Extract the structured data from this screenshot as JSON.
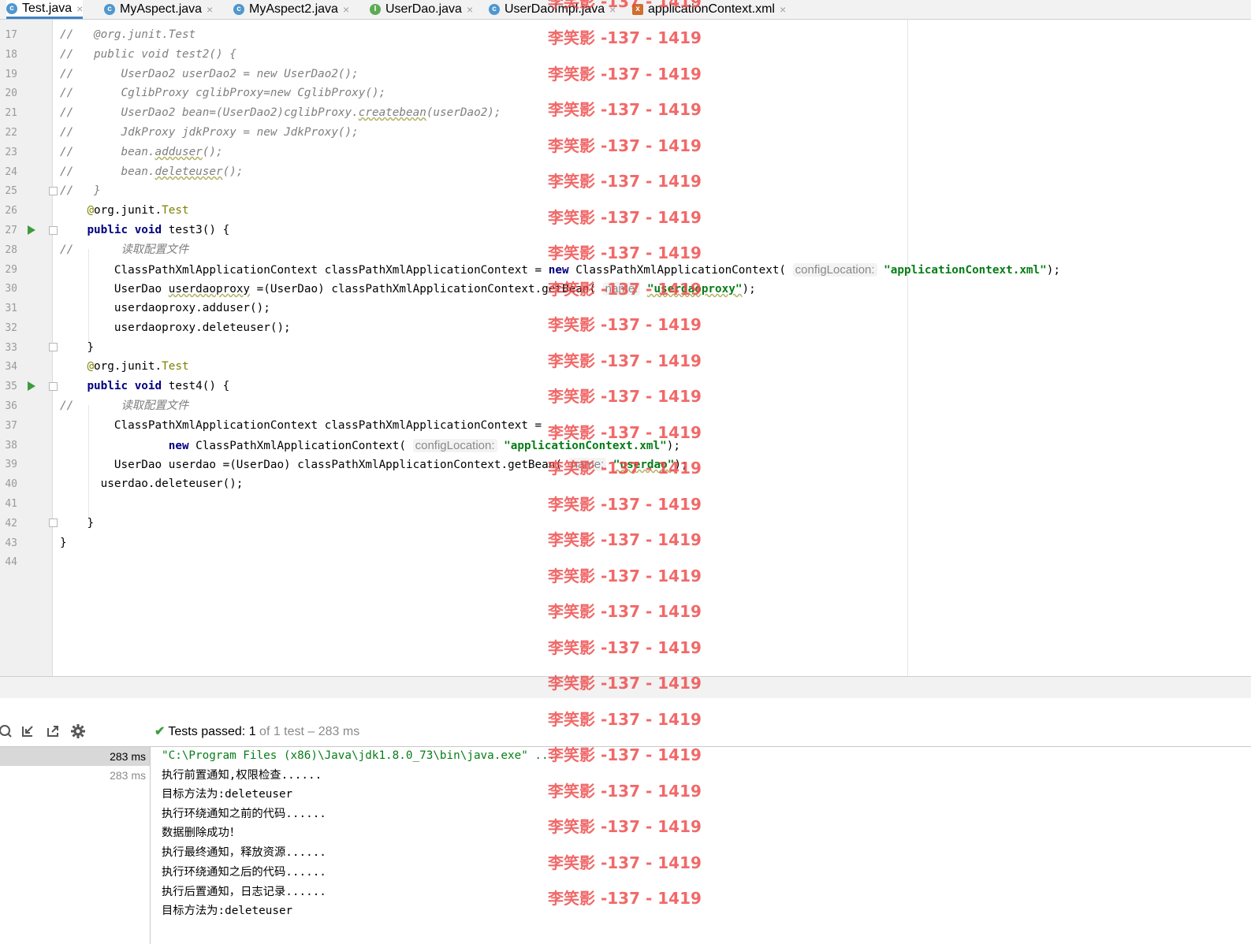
{
  "tabs": [
    {
      "label": "Test.java",
      "icon": "class-icon",
      "active": true
    },
    {
      "label": "MyAspect.java",
      "icon": "class-icon"
    },
    {
      "label": "MyAspect2.java",
      "icon": "class-icon"
    },
    {
      "label": "UserDao.java",
      "icon": "interface-icon"
    },
    {
      "label": "UserDaoImpl.java",
      "icon": "class-icon"
    },
    {
      "label": "applicationContext.xml",
      "icon": "xml-icon"
    }
  ],
  "tab_close_glyph": "×",
  "line_numbers": [
    "17",
    "18",
    "19",
    "20",
    "21",
    "22",
    "23",
    "24",
    "25",
    "26",
    "27",
    "28",
    "29",
    "30",
    "31",
    "32",
    "33",
    "34",
    "35",
    "36",
    "37",
    "38",
    "39",
    "40",
    "41",
    "42",
    "43",
    "44"
  ],
  "code": {
    "l17": {
      "cm": "//",
      "body": "@org.junit.Test"
    },
    "l18": {
      "cm": "//",
      "body": "public void test2() {"
    },
    "l19": {
      "cm": "//",
      "body": "UserDao2 userDao2 = new UserDao2();"
    },
    "l20": {
      "cm": "//",
      "body": "CglibProxy cglibProxy=new CglibProxy();"
    },
    "l21": {
      "cm": "//",
      "body_a": "UserDao2 bean=(UserDao2)cglibProxy.",
      "body_b": "createbean",
      "body_c": "(userDao2);"
    },
    "l22": {
      "cm": "//",
      "body": "JdkProxy jdkProxy = new JdkProxy();"
    },
    "l23": {
      "cm": "//",
      "body_a": "bean.",
      "body_b": "adduser",
      "body_c": "();"
    },
    "l24": {
      "cm": "//",
      "body_a": "bean.",
      "body_b": "deleteuser",
      "body_c": "();"
    },
    "l25": {
      "cm": "//",
      "body": "}"
    },
    "l26": {
      "at": "@",
      "pkg": "org.junit.",
      "ann": "Test"
    },
    "l27": {
      "kw": "public void",
      "rest": " test3() {"
    },
    "l28": {
      "cm": "//",
      "body": "读取配置文件"
    },
    "l29": {
      "a": "ClassPathXmlApplicationContext classPathXmlApplicationContext = ",
      "kw": "new",
      "b": " ClassPathXmlApplicationContext(",
      "hint": "configLocation:",
      "str": "\"applicationContext.xml\"",
      "c": ");"
    },
    "l30": {
      "a": "UserDao ",
      "wavy": "userdaoproxy",
      "b": " =(UserDao) classPathXmlApplicationContext.getBean(",
      "hint": "name:",
      "str": "\"userdaoproxy\"",
      "c": ");"
    },
    "l31": {
      "body": "userdaoproxy.adduser();"
    },
    "l32": {
      "body": "userdaoproxy.deleteuser();"
    },
    "l33": {
      "body": "}"
    },
    "l34": {
      "at": "@",
      "pkg": "org.junit.",
      "ann": "Test"
    },
    "l35": {
      "kw": "public void",
      "rest": " test4() {"
    },
    "l36": {
      "cm": "//",
      "body": "读取配置文件"
    },
    "l37": {
      "body": "ClassPathXmlApplicationContext classPathXmlApplicationContext ="
    },
    "l38": {
      "kw": "new",
      "b": " ClassPathXmlApplicationContext(",
      "hint": "configLocation:",
      "str": "\"applicationContext.xml\"",
      "c": ");"
    },
    "l39": {
      "a": "UserDao userdao =(UserDao) classPathXmlApplicationContext.getBean(",
      "hint": "name:",
      "str": "\"userdao\"",
      "c": ");"
    },
    "l40": {
      "body": "userdao.deleteuser();"
    },
    "l42": {
      "body": "}"
    },
    "l43": {
      "body": "}"
    }
  },
  "watermark": "李笑影 -137 - 1419",
  "run_panel": {
    "toolbar_icons": [
      "history-icon",
      "import-icon",
      "export-icon",
      "gear-icon"
    ],
    "status": {
      "check": "✔",
      "label": "Tests passed:",
      "passed": "1",
      "rest": "of 1 test – 283 ms"
    },
    "tree": [
      {
        "time": "283 ms",
        "selected": true
      },
      {
        "time": "283 ms",
        "selected": false
      }
    ],
    "console": [
      "\"C:\\Program Files (x86)\\Java\\jdk1.8.0_73\\bin\\java.exe\" ...",
      "执行前置通知,权限检查......",
      "目标方法为:deleteuser",
      "执行环绕通知之前的代码......",
      "数据删除成功！",
      "执行最终通知，释放资源......",
      "执行环绕通知之后的代码......",
      "执行后置通知，日志记录......",
      "目标方法为:deleteuser"
    ]
  },
  "colors": {
    "keyword": "#000080",
    "string": "#067d17",
    "comment": "#7f7f7f",
    "annotation": "#808000",
    "watermark": "#ee4848",
    "pass": "#3e9b3e"
  }
}
